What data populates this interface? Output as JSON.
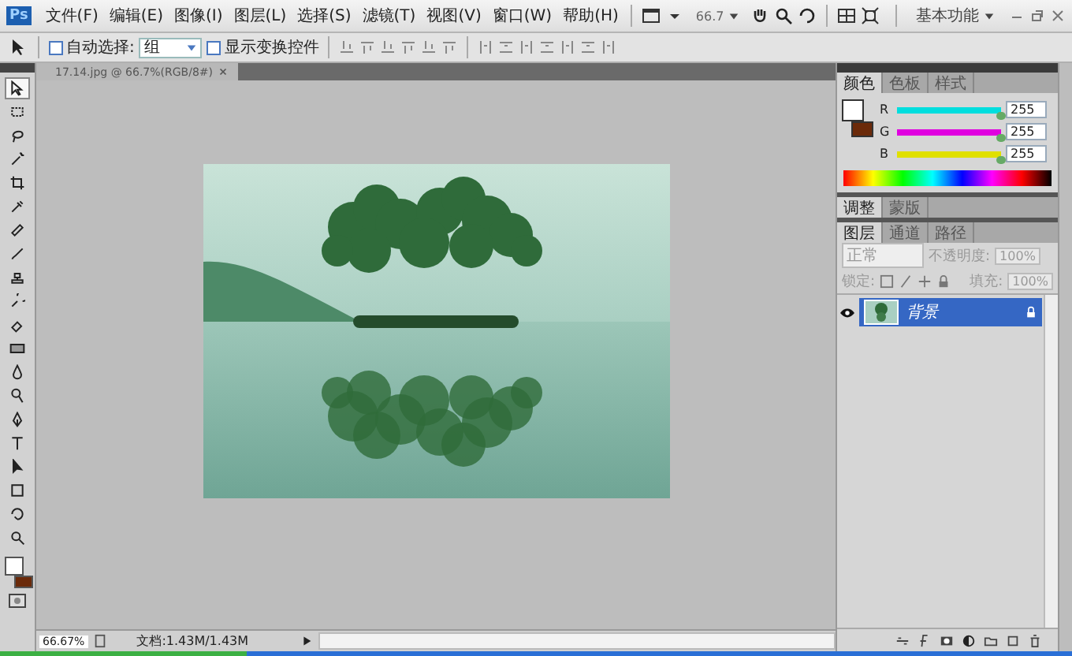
{
  "app_logo": "Ps",
  "menu_bar": {
    "items": [
      "文件(F)",
      "编辑(E)",
      "图像(I)",
      "图层(L)",
      "选择(S)",
      "滤镜(T)",
      "视图(V)",
      "窗口(W)",
      "帮助(H)"
    ],
    "zoom": "66.7",
    "workspace": "基本功能"
  },
  "options_bar": {
    "auto_select": {
      "label": "自动选择:",
      "checked": false
    },
    "auto_select_target": "组",
    "show_transform": {
      "label": "显示变换控件",
      "checked": false
    }
  },
  "document": {
    "tab_title": "17.14.jpg @ 66.7%(RGB/8#)"
  },
  "tools": [
    {
      "kind": "move",
      "selected": true
    },
    {
      "kind": "marquee",
      "selected": false
    },
    {
      "kind": "lasso",
      "selected": false
    },
    {
      "kind": "wand",
      "selected": false
    },
    {
      "kind": "crop",
      "selected": false
    },
    {
      "kind": "eyedropper",
      "selected": false
    },
    {
      "kind": "healing",
      "selected": false
    },
    {
      "kind": "brush",
      "selected": false
    },
    {
      "kind": "stamp",
      "selected": false
    },
    {
      "kind": "history",
      "selected": false
    },
    {
      "kind": "eraser",
      "selected": false
    },
    {
      "kind": "gradient",
      "selected": false
    },
    {
      "kind": "blur",
      "selected": false
    },
    {
      "kind": "dodge",
      "selected": false
    },
    {
      "kind": "pen",
      "selected": false
    },
    {
      "kind": "type",
      "selected": false
    },
    {
      "kind": "path",
      "selected": false
    },
    {
      "kind": "shape",
      "selected": false
    },
    {
      "kind": "rotate",
      "selected": false
    },
    {
      "kind": "zoom",
      "selected": false
    }
  ],
  "tool_colors": [
    {
      "kind": "foreground",
      "color": "#ffffff"
    },
    {
      "kind": "background",
      "color": "#6b2a0a"
    }
  ],
  "color_panel": {
    "tabs": [
      {
        "label": "颜色",
        "selected": true
      },
      {
        "label": "色板",
        "selected": false
      },
      {
        "label": "样式",
        "selected": false
      }
    ],
    "swatches": [
      {
        "kind": "foreground",
        "color": "#ffffff"
      },
      {
        "kind": "background",
        "color": "#6b2a0a"
      }
    ],
    "channels": [
      {
        "label": "R",
        "value": "255",
        "level": 1,
        "color": "#00dede"
      },
      {
        "label": "G",
        "value": "255",
        "level": 1,
        "color": "#e000e0"
      },
      {
        "label": "B",
        "value": "255",
        "level": 1,
        "color": "#e0e000"
      }
    ]
  },
  "adjust_panel": {
    "tabs": [
      {
        "label": "调整",
        "selected": true
      },
      {
        "label": "蒙版",
        "selected": false
      }
    ]
  },
  "layers_panel": {
    "tabs": [
      {
        "label": "图层",
        "selected": true
      },
      {
        "label": "通道",
        "selected": false
      },
      {
        "label": "路径",
        "selected": false
      }
    ],
    "disabled": true,
    "blend_mode": "正常",
    "opacity_label": "不透明度:",
    "opacity": "100%",
    "lock_label": "锁定:",
    "fill_label": "填充:",
    "fill": "100%",
    "layers": [
      {
        "name": "背景",
        "selected": true,
        "visible": true,
        "locked": true
      }
    ]
  },
  "status_bar": {
    "zoom": "66.67%",
    "doc_info": "文档:1.43M/1.43M"
  }
}
